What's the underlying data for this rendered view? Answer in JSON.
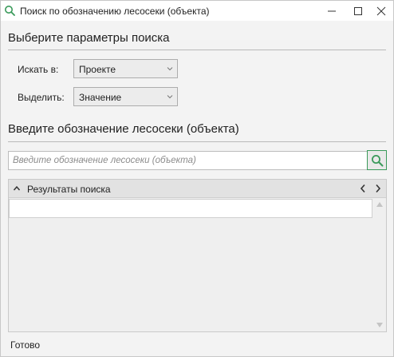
{
  "window": {
    "title": "Поиск по обозначению лесосеки (объекта)",
    "icon": "search-icon"
  },
  "params": {
    "section_title": "Выберите параметры поиска",
    "search_in_label": "Искать в:",
    "search_in_value": "Проекте",
    "select_label": "Выделить:",
    "select_value": "Значение"
  },
  "designation": {
    "section_title": "Введите обозначение лесосеки (объекта)",
    "input_value": "",
    "input_placeholder": "Введите обозначение лесосеки (объекта)"
  },
  "results": {
    "title": "Результаты поиска",
    "rows": []
  },
  "status": {
    "text": "Готово"
  },
  "colors": {
    "accent_green": "#3a9a5a"
  }
}
